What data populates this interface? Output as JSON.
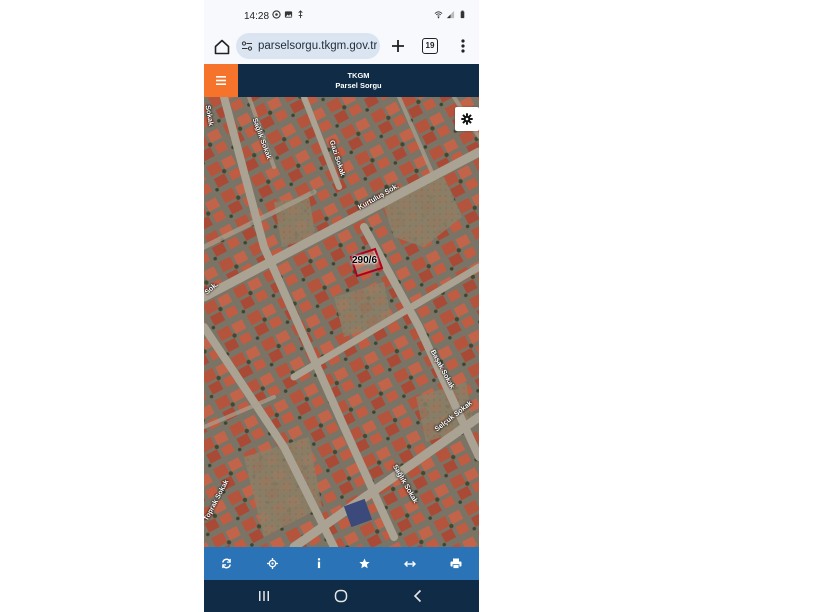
{
  "status_bar": {
    "time": "14:28",
    "left_icons": [
      "whatsapp-icon",
      "gallery-icon",
      "usb-icon"
    ],
    "right_icons": [
      "wifi-icon",
      "signal-icon",
      "battery-icon"
    ]
  },
  "browser": {
    "url": "parselsorgu.tkgm.gov.tr",
    "tab_count": "19"
  },
  "app": {
    "title_line1": "TKGM",
    "title_line2": "Parsel Sorgu",
    "brand_color": "#0f2b45",
    "accent_color": "#f5732b",
    "toolbar_color": "#2b73b7"
  },
  "map": {
    "parcel_label": "290/6",
    "streets": {
      "s1": "Sağlık Sokak",
      "s2": "Gazi Sokak",
      "s3": "Kurtuluş Sok.",
      "s4": "Başak Sokak",
      "s5": "Selçuk Sokak",
      "s6": "Sağlık Sokak",
      "s7": "Sok.",
      "s8": "Toprak Sokak",
      "s9": "Sokak"
    }
  },
  "toolbar": {
    "buttons": [
      "refresh-icon",
      "locate-icon",
      "info-icon",
      "star-icon",
      "measure-icon",
      "print-icon"
    ]
  },
  "nav": {
    "buttons": [
      "recent-apps-icon",
      "home-icon",
      "back-icon"
    ]
  }
}
